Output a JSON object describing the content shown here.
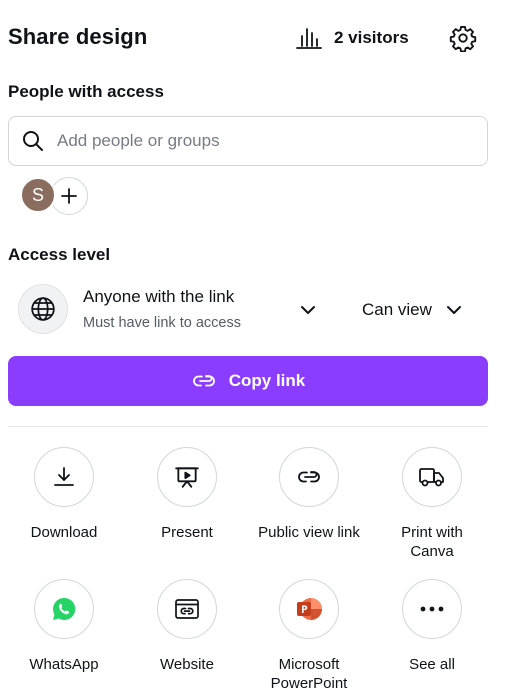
{
  "header": {
    "title": "Share design",
    "visitors_label": "2 visitors"
  },
  "people": {
    "heading": "People with access",
    "search_placeholder": "Add people or groups",
    "avatar_initial": "S",
    "avatar_color": "#8a6d5e"
  },
  "access": {
    "heading": "Access level",
    "link_setting": "Anyone with the link",
    "link_subtext": "Must have link to access",
    "permission": "Can view"
  },
  "copy_link": {
    "label": "Copy link",
    "color": "#8b3dff"
  },
  "actions": [
    {
      "label": "Download",
      "icon": "download-icon"
    },
    {
      "label": "Present",
      "icon": "present-icon"
    },
    {
      "label": "Public view link",
      "icon": "link-icon"
    },
    {
      "label": "Print with Canva",
      "icon": "truck-icon"
    },
    {
      "label": "WhatsApp",
      "icon": "whatsapp-icon"
    },
    {
      "label": "Website",
      "icon": "website-icon"
    },
    {
      "label": "Microsoft PowerPoint",
      "icon": "powerpoint-icon"
    },
    {
      "label": "See all",
      "icon": "more-icon"
    }
  ]
}
